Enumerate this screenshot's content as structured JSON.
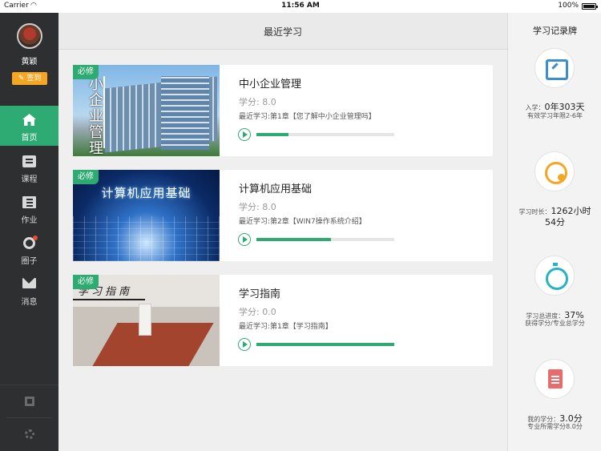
{
  "status_bar": {
    "carrier": "Carrier",
    "time": "11:56 AM",
    "battery": "100%"
  },
  "sidebar": {
    "username": "黄颖",
    "signin_label": "签到",
    "items": [
      {
        "label": "首页",
        "icon": "home-icon"
      },
      {
        "label": "课程",
        "icon": "course-icon"
      },
      {
        "label": "作业",
        "icon": "homework-icon"
      },
      {
        "label": "圈子",
        "icon": "circle-icon"
      },
      {
        "label": "消息",
        "icon": "message-icon"
      }
    ]
  },
  "header": {
    "title": "最近学习"
  },
  "courses": [
    {
      "badge": "必修",
      "title": "中小企业管理",
      "credit": "学分: 8.0",
      "recent": "最近学习:第1章【您了解中小企业管理吗】",
      "progress": 0.23,
      "thumb_text": "小企业管理"
    },
    {
      "badge": "必修",
      "title": "计算机应用基础",
      "credit": "学分: 8.0",
      "recent": "最近学习:第2章【WIN7操作系统介绍】",
      "progress": 0.54,
      "thumb_text": "计算机应用基础"
    },
    {
      "badge": "必修",
      "title": "学习指南",
      "credit": "学分: 0.0",
      "recent": "最近学习:第1章【学习指南】",
      "progress": 1.0,
      "thumb_text": "学习指南"
    }
  ],
  "records": {
    "title": "学习记录牌",
    "enroll": {
      "label": "入学：",
      "value": "0年303天",
      "sub": "有效学习年限2-6年"
    },
    "duration": {
      "label": "学习时长：",
      "value": "1262小时",
      "value2": "54分"
    },
    "progress": {
      "label": "学习总进度：",
      "value": "37%",
      "sub": "获得学分/专业总学分"
    },
    "credits": {
      "label": "我的学分：",
      "value": "3.0分",
      "sub": "专业所需学分8.0分"
    }
  },
  "colors": {
    "accent": "#2dab72",
    "signin": "#f5a623"
  }
}
